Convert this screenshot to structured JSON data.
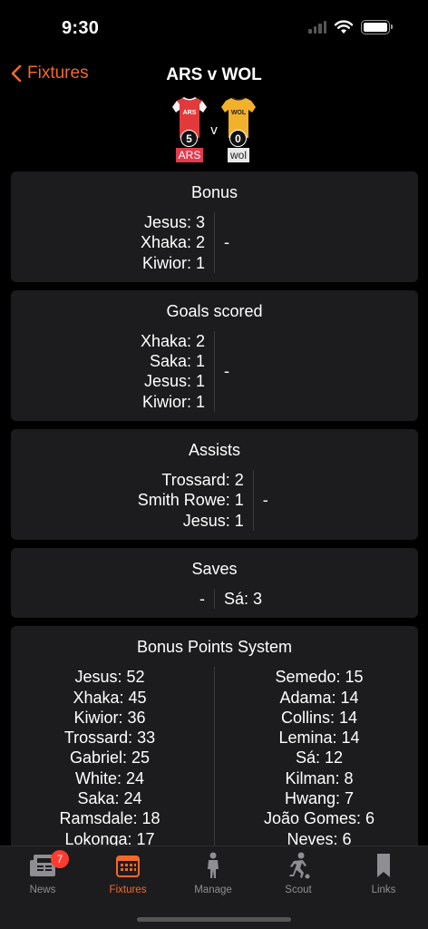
{
  "status": {
    "time": "9:30"
  },
  "nav": {
    "back_label": "Fixtures",
    "title": "ARS v WOL"
  },
  "match": {
    "home": {
      "code": "ARS",
      "score": "5",
      "shirt_color": "#e23a3a"
    },
    "away": {
      "code": "wol",
      "score": "0",
      "shirt_color": "#f3b12b"
    },
    "vs": "v"
  },
  "cards": {
    "bonus": {
      "title": "Bonus",
      "home": [
        "Jesus: 3",
        "Xhaka: 2",
        "Kiwior: 1"
      ],
      "away": "-"
    },
    "goals": {
      "title": "Goals scored",
      "home": [
        "Xhaka: 2",
        "Saka: 1",
        "Jesus: 1",
        "Kiwior: 1"
      ],
      "away": "-"
    },
    "assists": {
      "title": "Assists",
      "home": [
        "Trossard: 2",
        "Smith Rowe: 1",
        "Jesus: 1"
      ],
      "away": "-"
    },
    "saves": {
      "title": "Saves",
      "home": "-",
      "away": "Sá: 3"
    },
    "bps": {
      "title": "Bonus Points System",
      "home": [
        "Jesus: 52",
        "Xhaka: 45",
        "Kiwior: 36",
        "Trossard: 33",
        "Gabriel: 25",
        "White: 24",
        "Saka: 24",
        "Ramsdale: 18",
        "Lokonga: 17"
      ],
      "away": [
        "Semedo: 15",
        "Adama: 14",
        "Collins: 14",
        "Lemina: 14",
        "Sá: 12",
        "Kilman: 8",
        "Hwang: 7",
        "João Gomes: 6",
        "Neves: 6"
      ]
    }
  },
  "tabs": {
    "news": {
      "label": "News",
      "badge": "7"
    },
    "fixtures": {
      "label": "Fixtures"
    },
    "manage": {
      "label": "Manage"
    },
    "scout": {
      "label": "Scout"
    },
    "links": {
      "label": "Links"
    }
  },
  "colors": {
    "accent": "#f06a2a",
    "card_bg": "#1c1c1e",
    "badge": "#ff3b30"
  }
}
